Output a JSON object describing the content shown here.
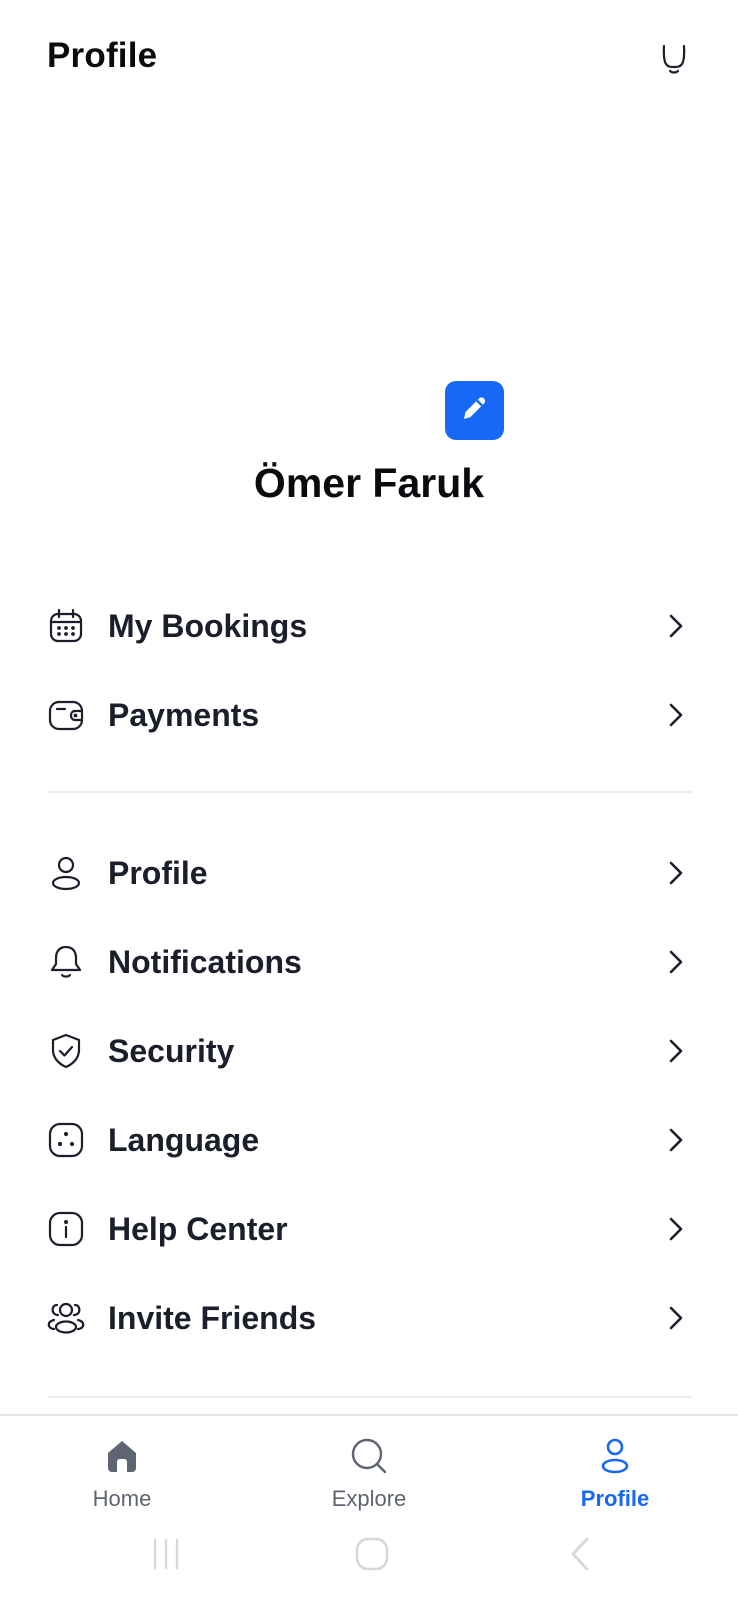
{
  "header": {
    "title": "Profile",
    "bell_icon": "bell-icon"
  },
  "profile": {
    "name": "Ömer Faruk",
    "edit_icon": "pencil-icon",
    "accent_color": "#1769f5"
  },
  "menu_groups": [
    {
      "items": [
        {
          "label": "My Bookings",
          "icon": "calendar-icon"
        },
        {
          "label": "Payments",
          "icon": "wallet-icon"
        }
      ]
    },
    {
      "items": [
        {
          "label": "Profile",
          "icon": "user-icon"
        },
        {
          "label": "Notifications",
          "icon": "bell-icon"
        },
        {
          "label": "Security",
          "icon": "shield-check-icon"
        },
        {
          "label": "Language",
          "icon": "language-icon"
        },
        {
          "label": "Help Center",
          "icon": "info-icon"
        },
        {
          "label": "Invite Friends",
          "icon": "users-icon"
        }
      ]
    }
  ],
  "bottom_nav": {
    "items": [
      {
        "label": "Home",
        "icon": "home-icon",
        "active": false
      },
      {
        "label": "Explore",
        "icon": "search-icon",
        "active": false
      },
      {
        "label": "Profile",
        "icon": "user-icon",
        "active": true
      }
    ]
  },
  "system_nav": {
    "buttons": [
      "recents-icon",
      "home-button-icon",
      "back-icon"
    ]
  }
}
